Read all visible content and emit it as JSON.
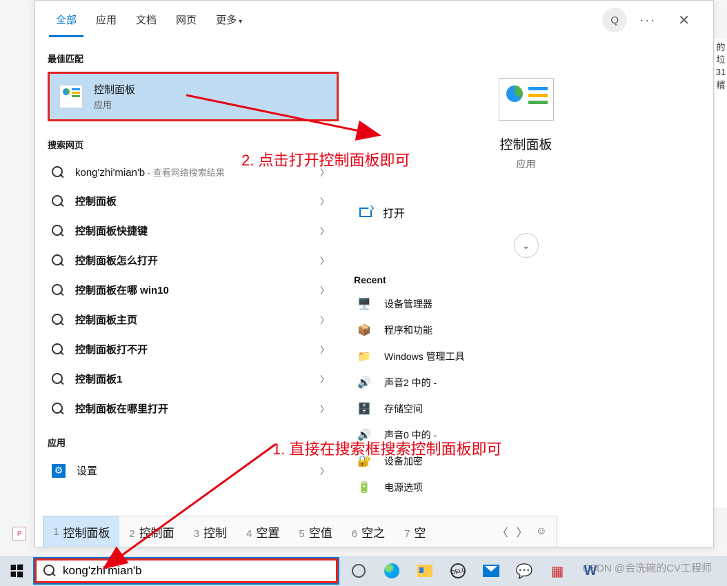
{
  "tabs": {
    "all": "全部",
    "apps": "应用",
    "docs": "文档",
    "web": "网页",
    "more": "更多",
    "account_initial": "Q"
  },
  "sections": {
    "best_match": "最佳匹配",
    "search_web": "搜索网页",
    "apps": "应用"
  },
  "best_match": {
    "title": "控制面板",
    "subtitle": "应用"
  },
  "web_sugg1": {
    "term": "kong'zhi'mian'b",
    "suffix": " - 查看网络搜索结果"
  },
  "web_suggestions": [
    "控制面板",
    "控制面板快捷键",
    "控制面板怎么打开",
    "控制面板在哪 win10",
    "控制面板主页",
    "控制面板打不开",
    "控制面板1",
    "控制面板在哪里打开"
  ],
  "app_settings": "设置",
  "preview": {
    "title": "控制面板",
    "subtitle": "应用",
    "open": "打开",
    "recent_header": "Recent"
  },
  "recent": [
    "设备管理器",
    "程序和功能",
    "Windows 管理工具",
    "声音2 中的 -",
    "存储空间",
    "声音0 中的 -",
    "设备加密",
    "电源选项"
  ],
  "ime": {
    "candidates": [
      "控制面板",
      "控制面",
      "控制",
      "空置",
      "空值",
      "空之",
      "空"
    ]
  },
  "search_input": {
    "value": "kong'zhi'mian'b"
  },
  "annotations": {
    "step1": "1. 直接在搜索框搜索控制面板即可",
    "step2": "2. 点击打开控制面板即可"
  },
  "watermark": "CSDN @会洗碗的CV工程师",
  "side_text": "的垃 31 糈"
}
